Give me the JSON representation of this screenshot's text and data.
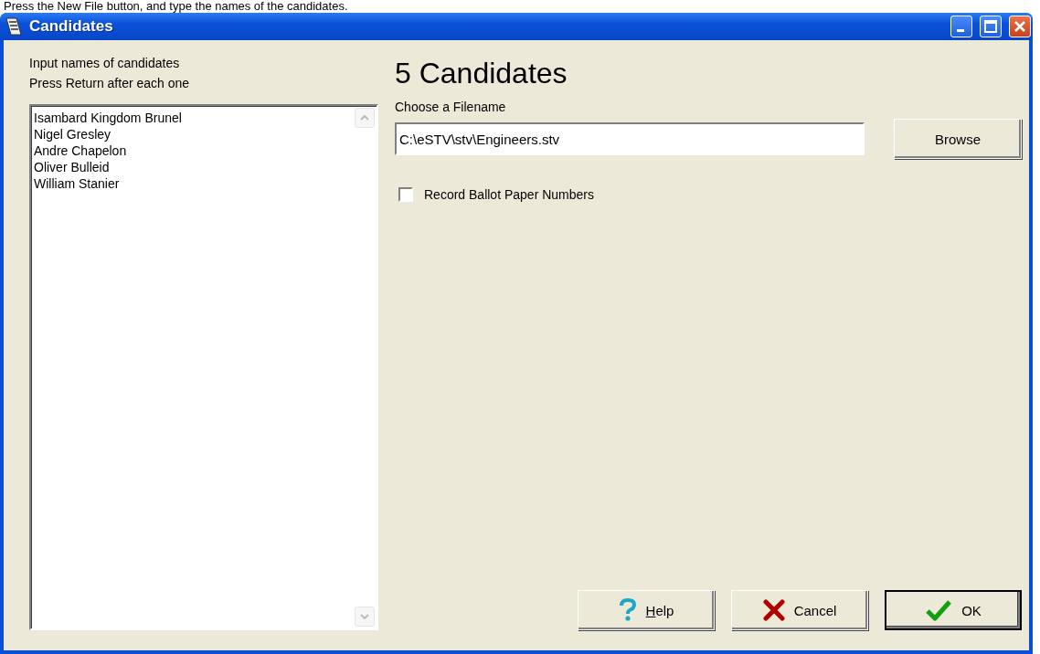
{
  "caption": "Press the New File button, and type the names of the candidates.",
  "window": {
    "title": "Candidates"
  },
  "instructions": [
    "Input names of candidates",
    "Press Return after each one"
  ],
  "candidates": [
    "Isambard Kingdom Brunel",
    "Nigel Gresley",
    "Andre Chapelon",
    "Oliver Bulleid",
    "William Stanier"
  ],
  "heading": "5 Candidates",
  "filename": {
    "label": "Choose a Filename",
    "value": "C:\\eSTV\\stv\\Engineers.stv",
    "browse": "Browse"
  },
  "record_ballot_numbers": {
    "label": "Record Ballot Paper Numbers",
    "checked": false
  },
  "buttons": [
    {
      "kind": "help",
      "label": "Help",
      "default": false
    },
    {
      "kind": "cancel",
      "label": "Cancel",
      "default": false
    },
    {
      "kind": "ok",
      "label": "OK",
      "default": true
    }
  ]
}
